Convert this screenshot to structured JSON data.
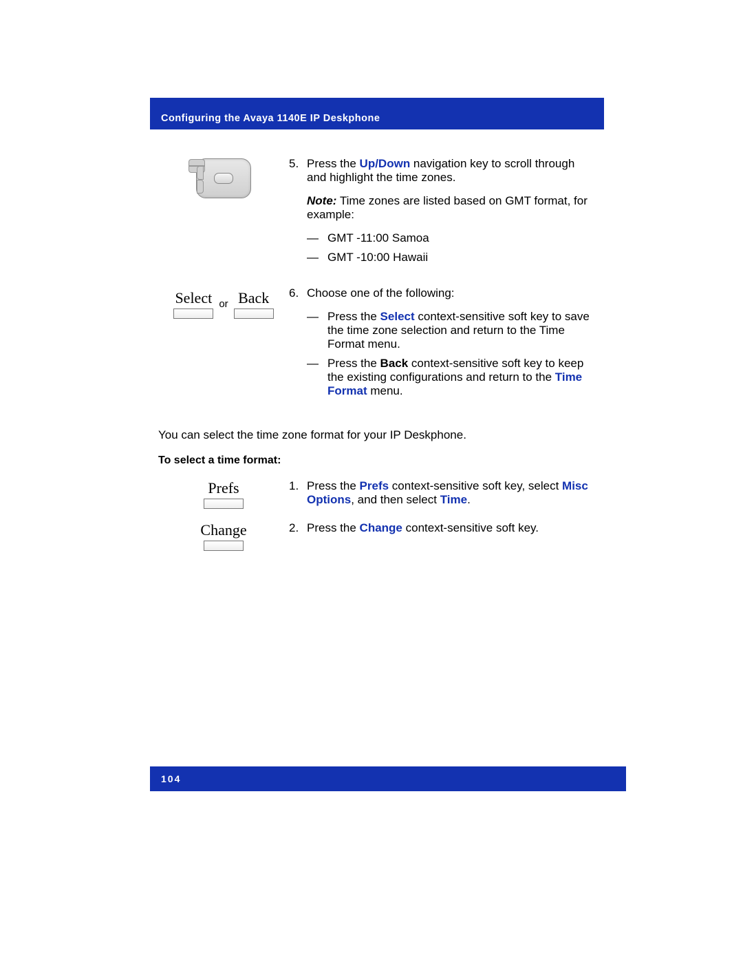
{
  "header": {
    "title": "Configuring the Avaya 1140E IP Deskphone"
  },
  "step5": {
    "num": "5.",
    "line1_prefix": "Press the ",
    "updown": "Up/Down",
    "line1_suffix": " navigation key to scroll through and highlight the time zones.",
    "note_label": "Note:",
    "note_text": "  Time zones are listed based on GMT format, for example:",
    "dash": "—",
    "tz1": "GMT -11:00 Samoa",
    "tz2": "GMT -10:00 Hawaii"
  },
  "step6": {
    "num": "6.",
    "intro": "Choose one of the following:",
    "dash": "—",
    "opt1_prefix": "Press the ",
    "select_label": "Select",
    "opt1_suffix": " context-sensitive soft key to save the time zone selection and return to the Time Format menu.",
    "opt2_prefix": "Press the ",
    "back_label": "Back",
    "opt2_mid": " context-sensitive soft key to keep the existing configurations and return to the ",
    "time_format": "Time Format",
    "opt2_end": " menu."
  },
  "softkeys_row1": {
    "select": "Select",
    "back": "Back",
    "or": "or"
  },
  "para1": "You can select the time zone format for your IP Deskphone.",
  "heading1": "To select a time format:",
  "softkeys_prefs": {
    "label": "Prefs"
  },
  "softkeys_change": {
    "label": "Change"
  },
  "step_tf1": {
    "num": "1.",
    "prefix": "Press the ",
    "prefs": "Prefs",
    "mid1": " context-sensitive soft key, select ",
    "misc": "Misc Options",
    "mid2": ", and then select ",
    "time": "Time",
    "end": "."
  },
  "step_tf2": {
    "num": "2.",
    "prefix": "Press the ",
    "change": "Change",
    "suffix": " context-sensitive soft key."
  },
  "footer": {
    "page": "104"
  }
}
